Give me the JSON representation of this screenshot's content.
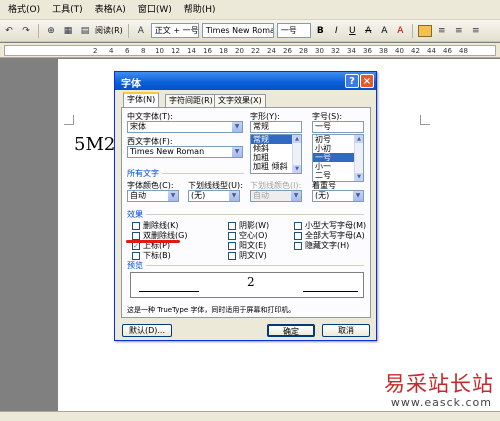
{
  "menubar": {
    "items": [
      "格式(O)",
      "工具(T)",
      "表格(A)",
      "窗口(W)",
      "帮助(H)"
    ]
  },
  "toolbar": {
    "reading_label": "阅读(R)",
    "style": "正文 + 一号",
    "font": "Times New Roman",
    "size": "一号",
    "bold": "B",
    "italic": "I",
    "underline": "U",
    "strike": "A",
    "zoom_a": "A",
    "highlight": "A"
  },
  "ruler": {
    "ticks": [
      "2",
      "4",
      "6",
      "8",
      "10",
      "12",
      "14",
      "16",
      "18",
      "20",
      "22",
      "24",
      "26",
      "28",
      "30",
      "32",
      "34",
      "36",
      "38",
      "40",
      "42",
      "44",
      "46",
      "48"
    ]
  },
  "document": {
    "text": "5M2"
  },
  "dialog": {
    "title": "字体",
    "help": "?",
    "close": "×",
    "tabs": [
      "字体(N)",
      "字符间距(R)",
      "文字效果(X)"
    ],
    "chinese_font_label": "中文字体(T):",
    "chinese_font_value": "宋体",
    "western_font_label": "西文字体(F):",
    "western_font_value": "Times New Roman",
    "style_label": "字形(Y):",
    "style_value": "常规",
    "style_options": [
      "常规",
      "倾斜",
      "加粗",
      "加粗 倾斜"
    ],
    "size_label": "字号(S):",
    "size_value": "一号",
    "size_options": [
      "初号",
      "小初",
      "一号",
      "小一",
      "二号"
    ],
    "all_text_title": "所有文字",
    "font_color_label": "字体颜色(C):",
    "font_color_value": "自动",
    "underline_type_label": "下划线线型(U):",
    "underline_type_value": "(无)",
    "underline_color_label": "下划线颜色(I):",
    "underline_color_value": "自动",
    "emphasis_label": "着重号",
    "emphasis_value": "(无)",
    "effects_title": "效果",
    "effects_left": [
      {
        "label": "删除线(K)",
        "checked": false
      },
      {
        "label": "双删除线(G)",
        "checked": false
      },
      {
        "label": "上标(P)",
        "checked": true
      },
      {
        "label": "下标(B)",
        "checked": false
      }
    ],
    "effects_mid": [
      "阴影(W)",
      "空心(O)",
      "阳文(E)",
      "阴文(V)"
    ],
    "effects_right": [
      "小型大写字母(M)",
      "全部大写字母(A)",
      "隐藏文字(H)"
    ],
    "preview_title": "预览",
    "preview_text": "2",
    "truetype_note": "这是一种 TrueType 字体，同时适用于屏幕和打印机。",
    "default_button": "默认(D)...",
    "ok_button": "确定",
    "cancel_button": "取消"
  },
  "watermark": {
    "title": "易采站长站",
    "url": "www.easck.com"
  }
}
